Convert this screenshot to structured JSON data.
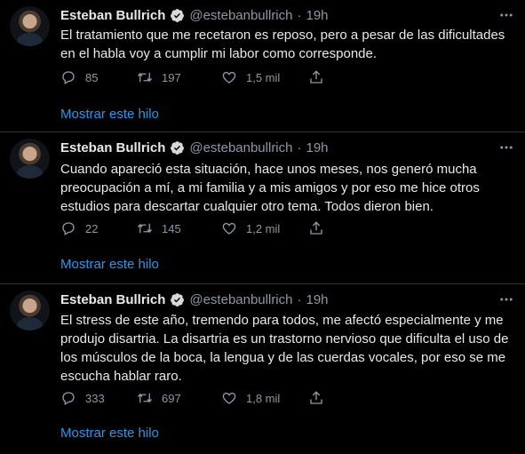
{
  "colors": {
    "background": "#000000",
    "link": "#1d9bf0",
    "muted": "#8b98a5",
    "text": "#e7e9ea",
    "verified": "#1d9bf0"
  },
  "tweets": [
    {
      "author": "Esteban Bullrich",
      "handle": "@estebanbullrich",
      "separator": "·",
      "time": "19h",
      "verified": true,
      "text": "El tratamiento que me recetaron es reposo, pero a pesar de las dificultades\nen el habla voy a cumplir mi labor como corresponde.",
      "replies": "85",
      "retweets": "197",
      "likes": "1,5 mil",
      "thread_link": "Mostrar este hilo"
    },
    {
      "author": "Esteban Bullrich",
      "handle": "@estebanbullrich",
      "separator": "·",
      "time": "19h",
      "verified": true,
      "text": "Cuando apareció esta situación, hace unos meses, nos generó mucha\npreocupación a mí, a mi familia y a mis amigos y por eso me hice otros\nestudios para descartar cualquier otro tema. Todos dieron bien.",
      "replies": "22",
      "retweets": "145",
      "likes": "1,2 mil",
      "thread_link": "Mostrar este hilo"
    },
    {
      "author": "Esteban Bullrich",
      "handle": "@estebanbullrich",
      "separator": "·",
      "time": "19h",
      "verified": true,
      "text": "El stress de este año, tremendo para todos, me afectó especialmente y me\nprodujo disartria. La disartria es un trastorno nervioso que dificulta el uso de\nlos músculos de la boca, la lengua y de las cuerdas vocales, por eso se me\nescucha hablar raro.",
      "replies": "333",
      "retweets": "697",
      "likes": "1,8 mil",
      "thread_link": "Mostrar este hilo"
    }
  ]
}
